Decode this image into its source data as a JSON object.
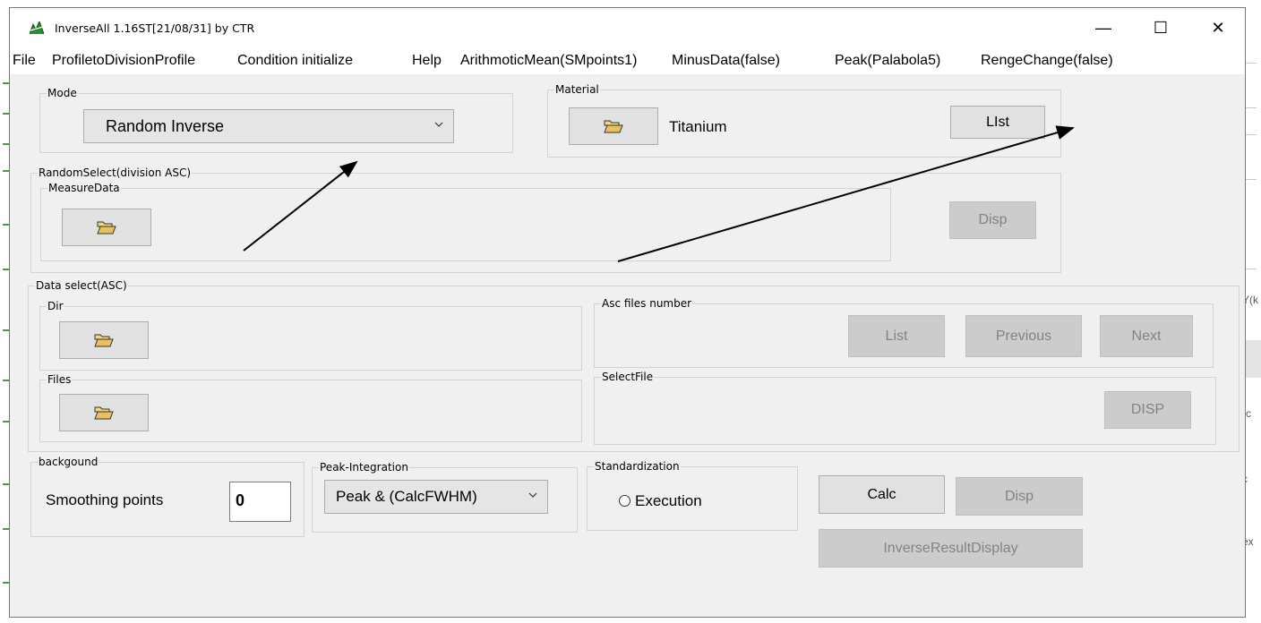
{
  "window": {
    "title": "InverseAll 1.16ST[21/08/31] by CTR",
    "minimize_glyph": "—",
    "maximize_glyph": "☐",
    "close_glyph": "✕"
  },
  "menu": [
    "File",
    "ProfiletoDivisionProfile",
    "Condition initialize",
    "Help",
    "ArithmoticMean(SMpoints1)",
    "MinusData(false)",
    "Peak(Palabola5)",
    "RengeChange(false)"
  ],
  "mode": {
    "legend": "Mode",
    "selected": "Random Inverse"
  },
  "material": {
    "legend": "Material",
    "name": "Titanium",
    "list_button": "LIst"
  },
  "random_select": {
    "legend": "RandomSelect(division ASC)",
    "measure_legend": "MeasureData",
    "disp_button": "Disp"
  },
  "data_select": {
    "legend": "Data select(ASC)",
    "dir_legend": "Dir",
    "files_legend": "Files",
    "asc_legend": "Asc files number",
    "list_button": "List",
    "previous_button": "Previous",
    "next_button": "Next",
    "selectfile_legend": "SelectFile",
    "disp_button": "DISP"
  },
  "background": {
    "legend": "backgound",
    "smoothing_label": "Smoothing points",
    "smoothing_value": "0"
  },
  "peak_integration": {
    "legend": "Peak-Integration",
    "selected": "Peak & (CalcFWHM)"
  },
  "standardization": {
    "legend": "Standardization",
    "option": "Execution"
  },
  "actions": {
    "calc": "Calc",
    "disp": "Disp",
    "inverse_result": "InverseResultDisplay"
  },
  "colors": {
    "disabled_bg": "#cccccc",
    "disabled_text": "#838383",
    "window_bg": "#f0f0f0",
    "folder_yellow": "#e8c15c"
  },
  "background_fragments": [
    "Y(k",
    "(c",
    "ex",
    "c"
  ]
}
